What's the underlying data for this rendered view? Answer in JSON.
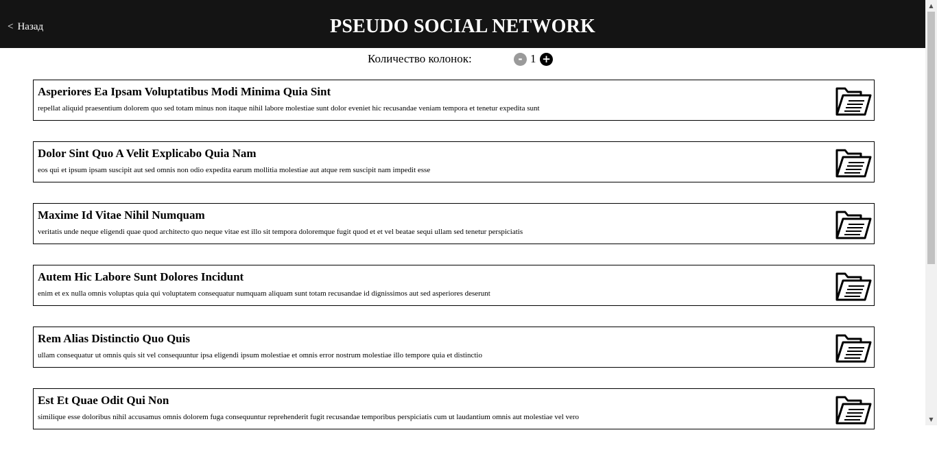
{
  "header": {
    "back_label": "Назад",
    "back_chevron": "<",
    "title": "PSEUDO SOCIAL NETWORK"
  },
  "controls": {
    "label": "Количество колонок:",
    "minus": "-",
    "count": "1",
    "plus": "+"
  },
  "posts": [
    {
      "title": "Asperiores Ea Ipsam Voluptatibus Modi Minima Quia Sint",
      "body": "repellat aliquid praesentium dolorem quo sed totam minus non itaque nihil labore molestiae sunt dolor eveniet hic recusandae veniam tempora et tenetur expedita sunt",
      "icon": "folder-document-icon"
    },
    {
      "title": "Dolor Sint Quo A Velit Explicabo Quia Nam",
      "body": "eos qui et ipsum ipsam suscipit aut sed omnis non odio expedita earum mollitia molestiae aut atque rem suscipit nam impedit esse",
      "icon": "folder-document-icon"
    },
    {
      "title": "Maxime Id Vitae Nihil Numquam",
      "body": "veritatis unde neque eligendi quae quod architecto quo neque vitae est illo sit tempora doloremque fugit quod et et vel beatae sequi ullam sed tenetur perspiciatis",
      "icon": "folder-document-icon"
    },
    {
      "title": "Autem Hic Labore Sunt Dolores Incidunt",
      "body": "enim et ex nulla omnis voluptas quia qui voluptatem consequatur numquam aliquam sunt totam recusandae id dignissimos aut sed asperiores deserunt",
      "icon": "folder-document-icon"
    },
    {
      "title": "Rem Alias Distinctio Quo Quis",
      "body": "ullam consequatur ut omnis quis sit vel consequuntur ipsa eligendi ipsum molestiae et omnis error nostrum molestiae illo tempore quia et distinctio",
      "icon": "folder-document-icon"
    },
    {
      "title": "Est Et Quae Odit Qui Non",
      "body": "similique esse doloribus nihil accusamus omnis dolorem fuga consequuntur reprehenderit fugit recusandae temporibus perspiciatis cum ut laudantium omnis aut molestiae vel vero",
      "icon": "folder-document-icon"
    }
  ],
  "colors": {
    "header_bg": "#141414",
    "minus_bg": "#9a9a9a",
    "plus_bg": "#000000"
  }
}
